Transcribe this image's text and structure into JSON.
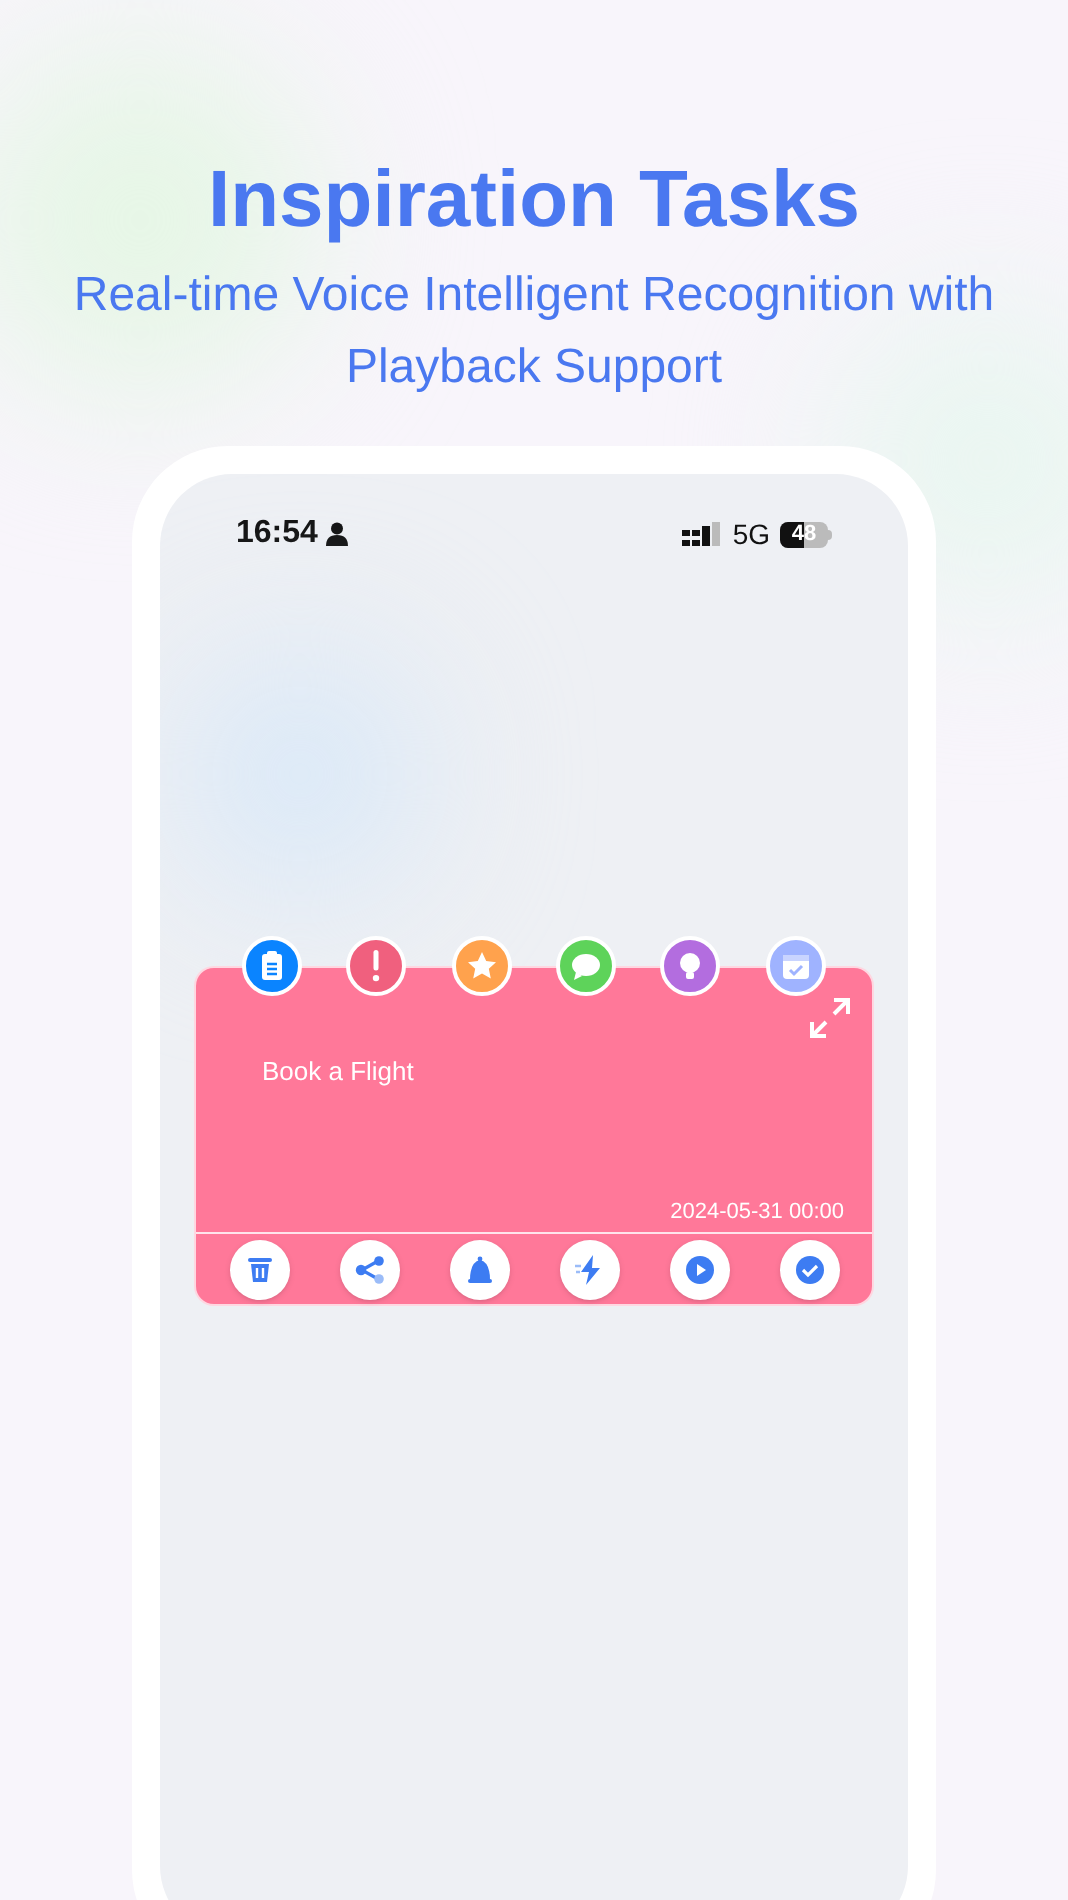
{
  "headline": {
    "title": "Inspiration Tasks",
    "subtitle": "Real-time Voice Intelligent Recognition with Playback Support"
  },
  "status_bar": {
    "time": "16:54",
    "network": "5G",
    "battery": "48"
  },
  "categories": [
    {
      "kind": "clipboard",
      "color": "#0a84ff"
    },
    {
      "kind": "exclamation",
      "color": "#f0607e"
    },
    {
      "kind": "star",
      "color": "#ffa24d"
    },
    {
      "kind": "chat",
      "color": "#5ed35a"
    },
    {
      "kind": "bulb",
      "color": "#b36ddf"
    },
    {
      "kind": "calendar",
      "color": "#9fb3ff"
    }
  ],
  "task": {
    "text": "Book a Flight",
    "date": "2024-05-31 00:00",
    "color": "#ff7899"
  },
  "actions": [
    {
      "kind": "delete"
    },
    {
      "kind": "share"
    },
    {
      "kind": "bell"
    },
    {
      "kind": "bolt"
    },
    {
      "kind": "play"
    },
    {
      "kind": "check"
    }
  ]
}
